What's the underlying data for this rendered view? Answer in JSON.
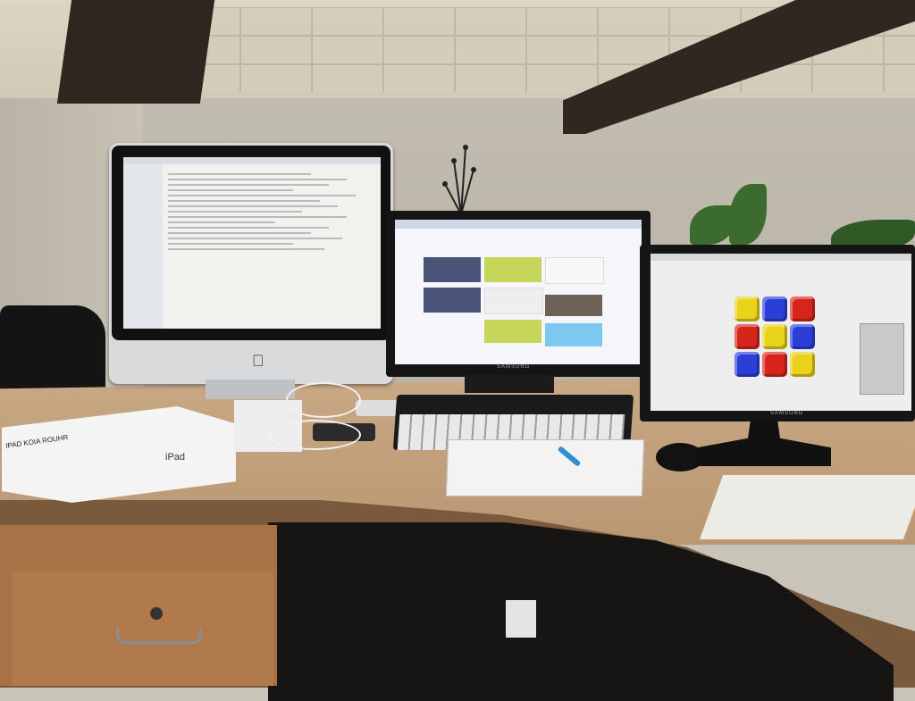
{
  "scene": {
    "caption_lines": [],
    "imac": {
      "logo_icon": "apple-logo"
    },
    "middle_monitor": {
      "brand": "SAMSUNG"
    },
    "right_monitor": {
      "brand": "SAMSUNG"
    },
    "ipad_box": {
      "label": "iPad",
      "note": "IPAD KOIA ROUHR"
    },
    "cube_colors": [
      [
        "#e8d21a",
        "#2b3fd8",
        "#d8251c"
      ],
      [
        "#d8251c",
        "#e8d21a",
        "#2b3fd8"
      ],
      [
        "#2b3fd8",
        "#d8251c",
        "#e8d21a"
      ]
    ]
  }
}
